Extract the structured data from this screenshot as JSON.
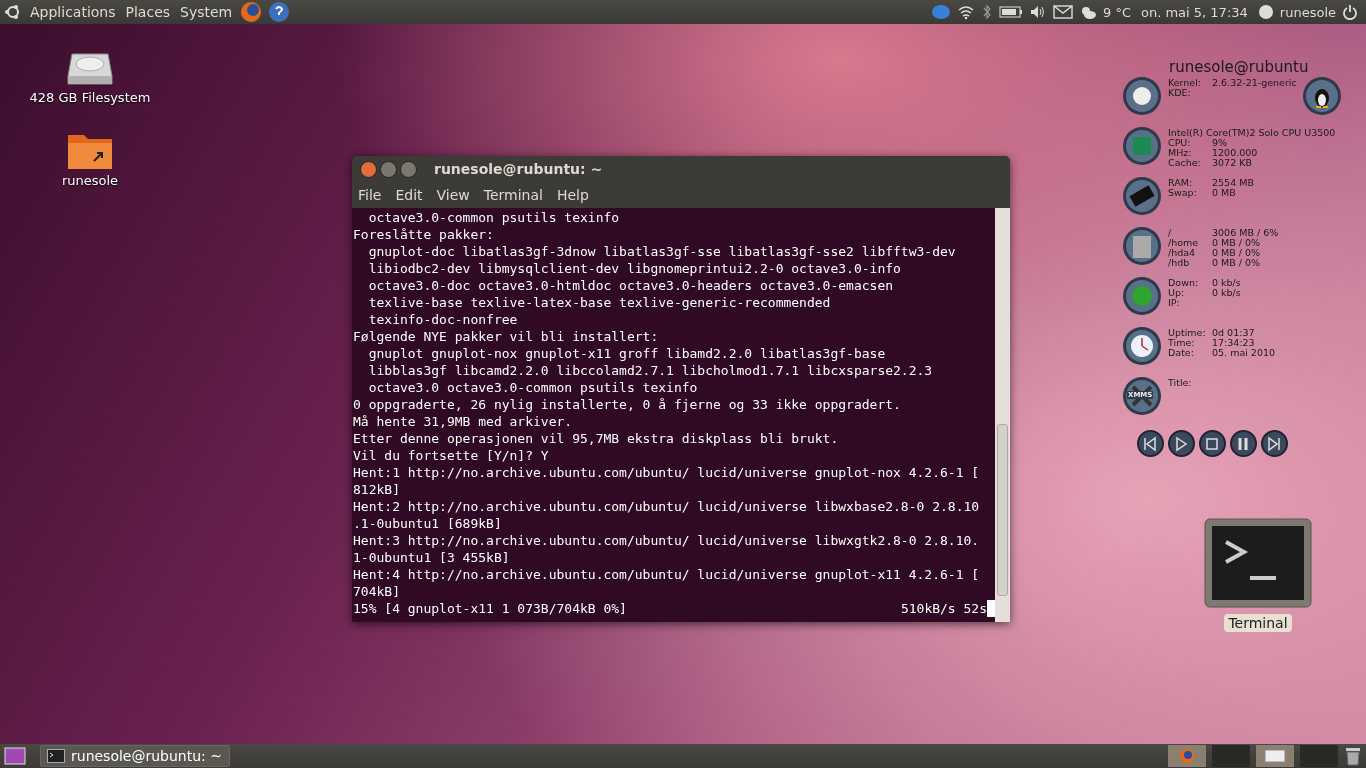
{
  "top_panel": {
    "menus": [
      {
        "label": "Applications"
      },
      {
        "label": "Places"
      },
      {
        "label": "System"
      }
    ],
    "weather": "9 °C",
    "clock": "on. mai  5, 17:34",
    "user": "runesole"
  },
  "desktop_icons": [
    {
      "label": "428 GB Filesystem",
      "kind": "drive"
    },
    {
      "label": "runesole",
      "kind": "folder"
    }
  ],
  "terminal": {
    "title": "runesole@rubuntu: ~",
    "menu": [
      "File",
      "Edit",
      "View",
      "Terminal",
      "Help"
    ],
    "lines": [
      "  octave3.0-common psutils texinfo",
      "Foreslåtte pakker:",
      "  gnuplot-doc libatlas3gf-3dnow libatlas3gf-sse libatlas3gf-sse2 libfftw3-dev",
      "  libiodbc2-dev libmysqlclient-dev libgnomeprintui2.2-0 octave3.0-info",
      "  octave3.0-doc octave3.0-htmldoc octave3.0-headers octave3.0-emacsen",
      "  texlive-base texlive-latex-base texlive-generic-recommended",
      "  texinfo-doc-nonfree",
      "Følgende NYE pakker vil bli installert:",
      "  gnuplot gnuplot-nox gnuplot-x11 groff libamd2.2.0 libatlas3gf-base",
      "  libblas3gf libcamd2.2.0 libccolamd2.7.1 libcholmod1.7.1 libcxsparse2.2.3",
      "  octave3.0 octave3.0-common psutils texinfo",
      "0 oppgraderte, 26 nylig installerte, 0 å fjerne og 33 ikke oppgradert.",
      "Må hente 31,9MB med arkiver.",
      "Etter denne operasjonen vil 95,7MB ekstra diskplass bli brukt.",
      "Vil du fortsette [Y/n]? Y",
      "Hent:1 http://no.archive.ubuntu.com/ubuntu/ lucid/universe gnuplot-nox 4.2.6-1 [",
      "812kB]",
      "Hent:2 http://no.archive.ubuntu.com/ubuntu/ lucid/universe libwxbase2.8-0 2.8.10",
      ".1-0ubuntu1 [689kB]",
      "Hent:3 http://no.archive.ubuntu.com/ubuntu/ lucid/universe libwxgtk2.8-0 2.8.10.",
      "1-0ubuntu1 [3 455kB]",
      "Hent:4 http://no.archive.ubuntu.com/ubuntu/ lucid/universe gnuplot-x11 4.2.6-1 [",
      "704kB]"
    ],
    "status_left": "15% [4 gnuplot-x11 1 073B/704kB 0%]",
    "status_right": "510kB/s 52s"
  },
  "conky": {
    "heading": "runesole@rubuntu",
    "sections": [
      {
        "kind": "kde",
        "rows": [
          {
            "label": "Kernel:",
            "value": "2.6.32-21-generic"
          },
          {
            "label": "KDE:",
            "value": ""
          }
        ]
      },
      {
        "kind": "cpu",
        "rows": [
          {
            "label": "Intel(R) Core(TM)2 Solo CPU     U3500",
            "value": ""
          },
          {
            "label": "CPU:",
            "value": "9%"
          },
          {
            "label": "MHz:",
            "value": "1200.000"
          },
          {
            "label": "Cache:",
            "value": "3072 KB"
          }
        ]
      },
      {
        "kind": "ram",
        "rows": [
          {
            "label": "RAM:",
            "value": "2554 MB"
          },
          {
            "label": "Swap:",
            "value": "0 MB"
          }
        ]
      },
      {
        "kind": "disk",
        "rows": [
          {
            "label": "/",
            "value": "3006 MB / 6%"
          },
          {
            "label": "/home",
            "value": "0 MB / 0%"
          },
          {
            "label": "/hda4",
            "value": "0 MB / 0%"
          },
          {
            "label": "/hdb",
            "value": "0 MB / 0%"
          }
        ]
      },
      {
        "kind": "net",
        "rows": [
          {
            "label": "Down:",
            "value": "0 kb/s"
          },
          {
            "label": "Up:",
            "value": "0 kb/s"
          },
          {
            "label": "IP:",
            "value": ""
          }
        ]
      },
      {
        "kind": "clock",
        "rows": [
          {
            "label": "Uptime:",
            "value": "0d 01:37"
          },
          {
            "label": "Time:",
            "value": "17:34:23"
          },
          {
            "label": "Date:",
            "value": "05. mai 2010"
          }
        ]
      },
      {
        "kind": "xmms",
        "rows": [
          {
            "label": "Title:",
            "value": ""
          }
        ]
      }
    ],
    "xmms_label": "XMMS"
  },
  "terminal_launcher": {
    "label": "Terminal"
  },
  "bottom_panel": {
    "task": "runesole@rubuntu: ~"
  }
}
